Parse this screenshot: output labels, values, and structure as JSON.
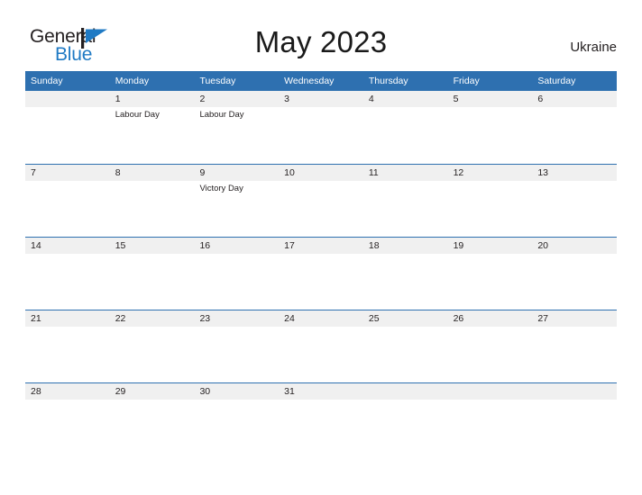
{
  "brand": {
    "name_part1": "General",
    "name_part2": "Blue",
    "flag_icon": "blue-flag-icon",
    "color_dark": "#231f20",
    "color_blue": "#1f7ac4"
  },
  "header": {
    "title": "May 2023",
    "country": "Ukraine"
  },
  "theme": {
    "header_blue": "#2e70b0",
    "date_band_gray": "#f0f0f0",
    "text_dark": "#231f20",
    "white": "#ffffff"
  },
  "calendar": {
    "month": "May",
    "year": "2023",
    "weekdays": [
      "Sunday",
      "Monday",
      "Tuesday",
      "Wednesday",
      "Thursday",
      "Friday",
      "Saturday"
    ],
    "weeks": [
      [
        {
          "date": "",
          "events": []
        },
        {
          "date": "1",
          "events": [
            "Labour Day"
          ]
        },
        {
          "date": "2",
          "events": [
            "Labour Day"
          ]
        },
        {
          "date": "3",
          "events": []
        },
        {
          "date": "4",
          "events": []
        },
        {
          "date": "5",
          "events": []
        },
        {
          "date": "6",
          "events": []
        }
      ],
      [
        {
          "date": "7",
          "events": []
        },
        {
          "date": "8",
          "events": []
        },
        {
          "date": "9",
          "events": [
            "Victory Day"
          ]
        },
        {
          "date": "10",
          "events": []
        },
        {
          "date": "11",
          "events": []
        },
        {
          "date": "12",
          "events": []
        },
        {
          "date": "13",
          "events": []
        }
      ],
      [
        {
          "date": "14",
          "events": []
        },
        {
          "date": "15",
          "events": []
        },
        {
          "date": "16",
          "events": []
        },
        {
          "date": "17",
          "events": []
        },
        {
          "date": "18",
          "events": []
        },
        {
          "date": "19",
          "events": []
        },
        {
          "date": "20",
          "events": []
        }
      ],
      [
        {
          "date": "21",
          "events": []
        },
        {
          "date": "22",
          "events": []
        },
        {
          "date": "23",
          "events": []
        },
        {
          "date": "24",
          "events": []
        },
        {
          "date": "25",
          "events": []
        },
        {
          "date": "26",
          "events": []
        },
        {
          "date": "27",
          "events": []
        }
      ],
      [
        {
          "date": "28",
          "events": []
        },
        {
          "date": "29",
          "events": []
        },
        {
          "date": "30",
          "events": []
        },
        {
          "date": "31",
          "events": []
        },
        {
          "date": "",
          "events": []
        },
        {
          "date": "",
          "events": []
        },
        {
          "date": "",
          "events": []
        }
      ]
    ]
  }
}
